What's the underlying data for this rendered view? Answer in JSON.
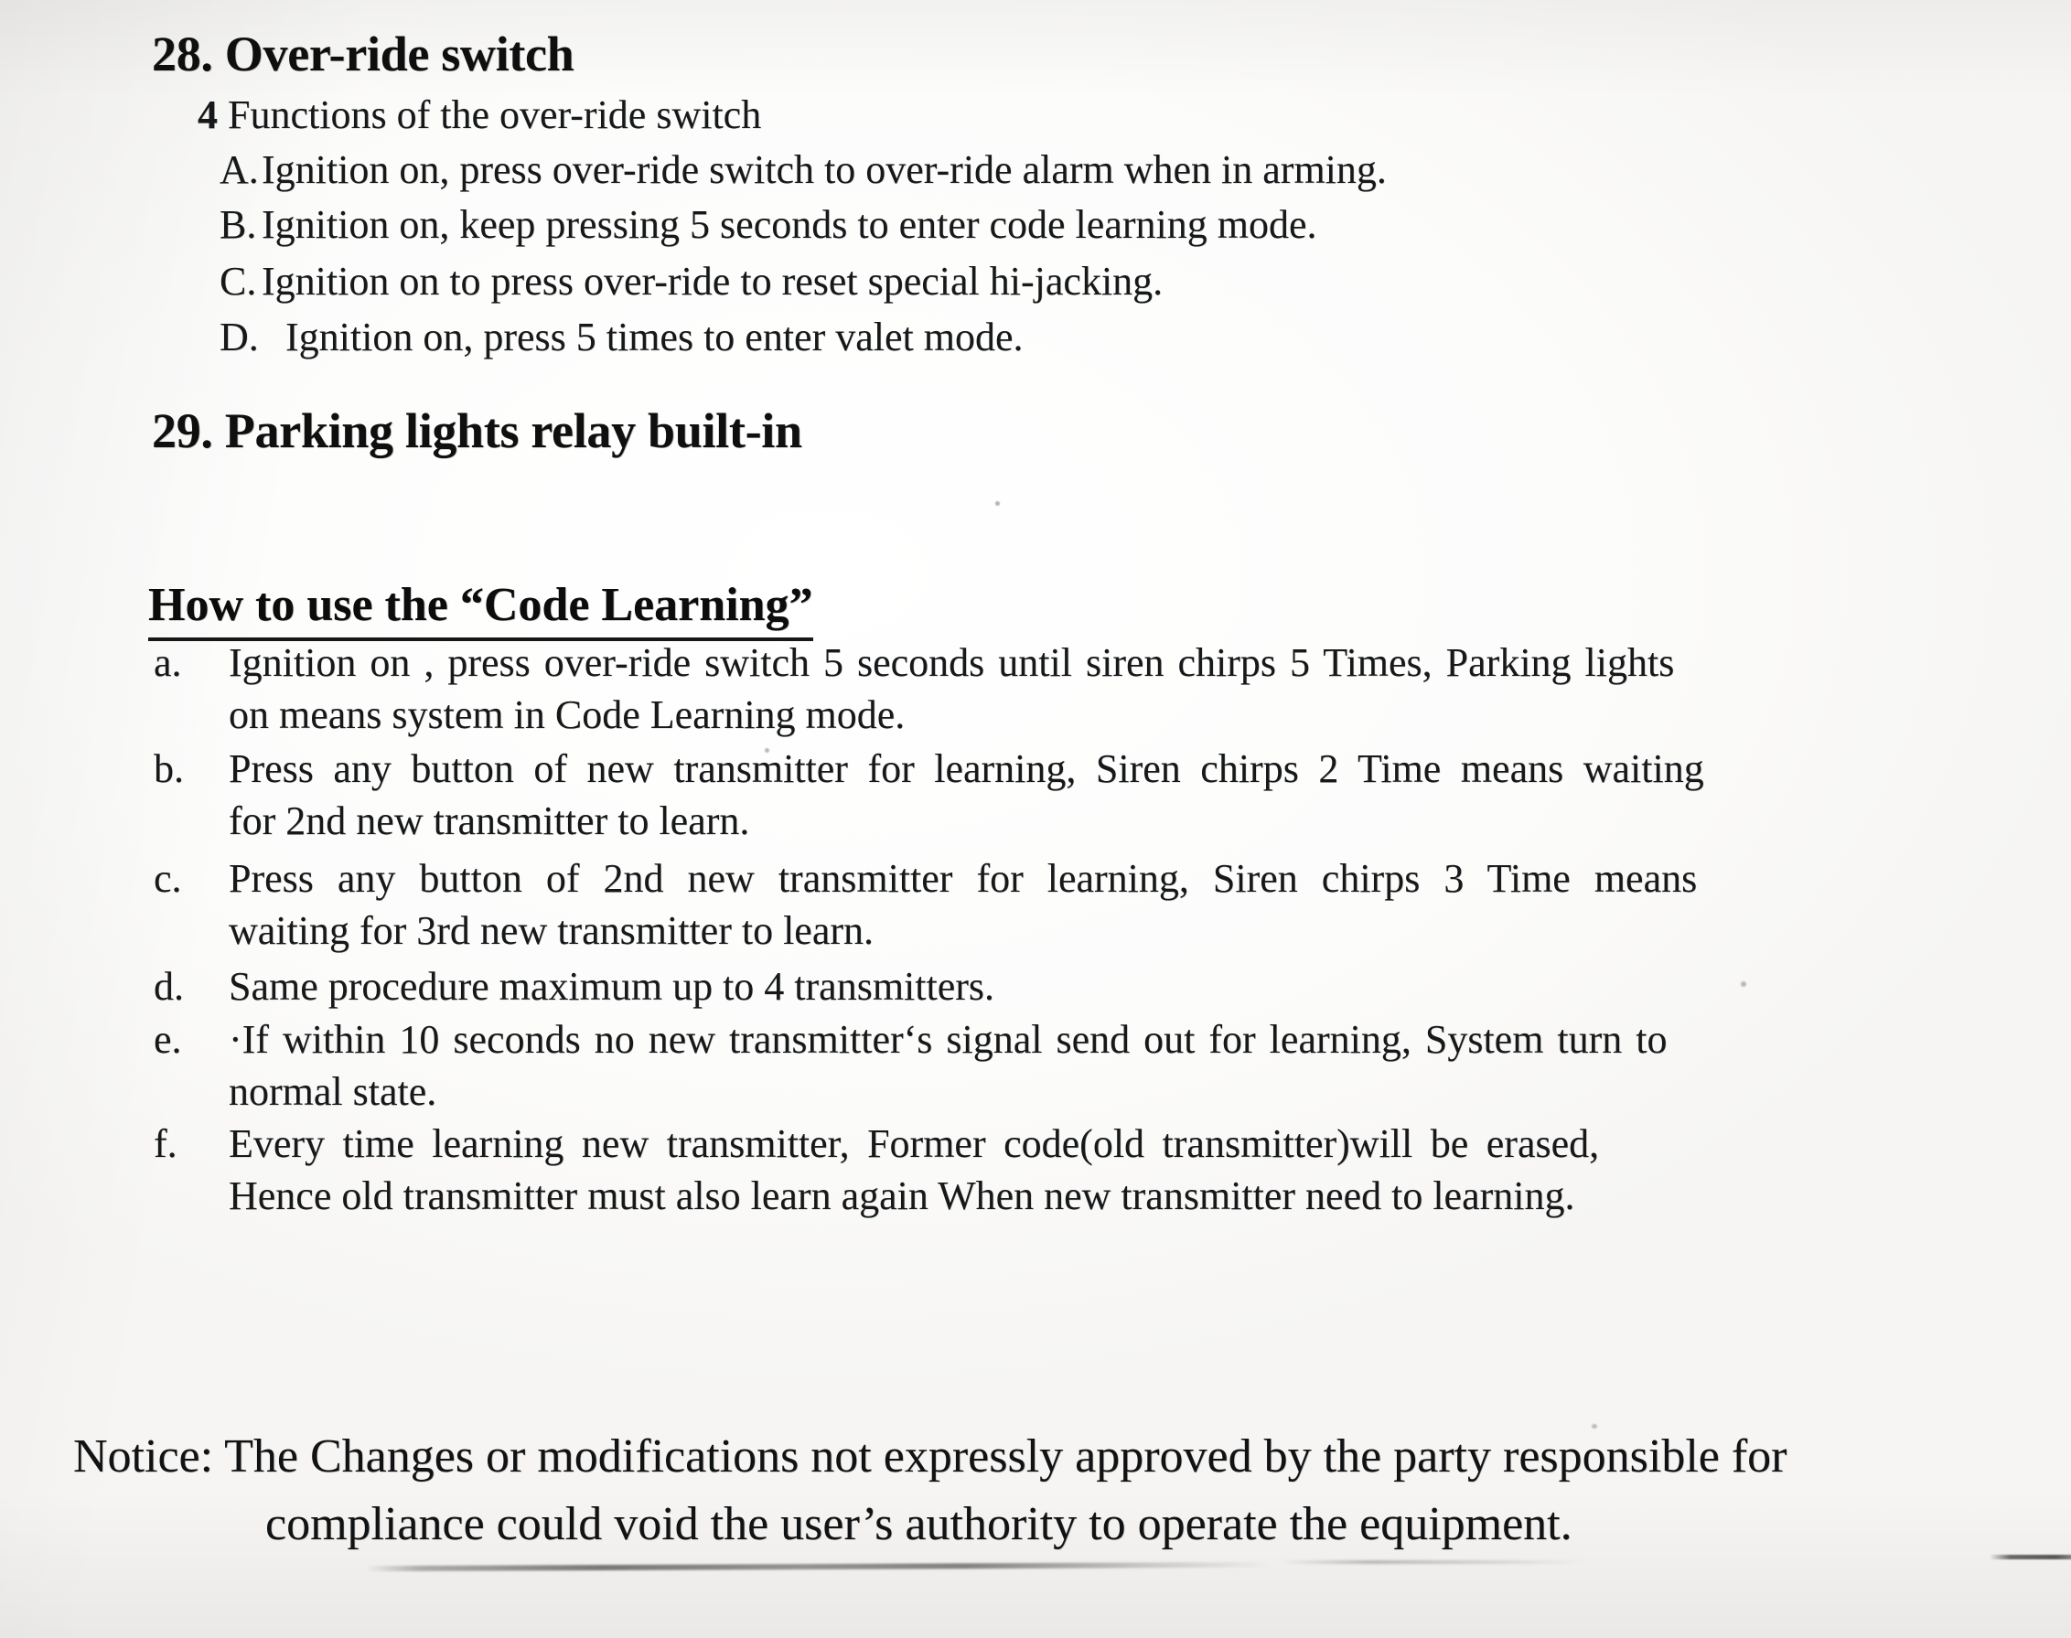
{
  "document": {
    "sections": [
      {
        "number": "28.",
        "title": "Over-ride switch",
        "heading_full": "28. Over-ride switch",
        "subheading_num": "4",
        "subheading_text": " Functions of the over-ride switch",
        "options": [
          {
            "letter": "A.",
            "text": "Ignition on, press over-ride switch to over-ride alarm when in arming."
          },
          {
            "letter": "B.",
            "text": "Ignition on, keep pressing 5 seconds to enter code learning mode."
          },
          {
            "letter": "C.",
            "text": "Ignition on to press over-ride to reset special hi-jacking."
          },
          {
            "letter": "D.",
            "text": "Ignition on, press 5 times to enter valet mode."
          }
        ]
      },
      {
        "number": "29.",
        "title": "Parking lights relay built-in",
        "heading_full": "29. Parking lights relay built-in"
      }
    ],
    "code_learning": {
      "heading": "How to use the “Code Learning”",
      "items": [
        {
          "marker": "a.",
          "line1": "Ignition on , press over-ride switch 5 seconds until siren chirps 5 Times, Parking lights",
          "line2": "on means system in Code Learning mode.",
          "full": "Ignition on , press over-ride switch 5 seconds until siren chirps 5 Times, Parking lights on means system in Code Learning mode."
        },
        {
          "marker": "b.",
          "line1": "Press any button of new transmitter for learning, Siren chirps 2 Time means waiting",
          "line2": "for 2nd new transmitter to learn.",
          "full": "Press any button of new transmitter for learning, Siren chirps 2 Time means waiting for 2nd new transmitter to learn."
        },
        {
          "marker": "c.",
          "line1": "Press any button of 2nd new transmitter for learning, Siren chirps 3 Time means",
          "line2": "waiting for 3rd new transmitter to learn.",
          "full": "Press any button of 2nd new transmitter for learning, Siren chirps 3 Time means waiting for 3rd new transmitter to learn."
        },
        {
          "marker": "d.",
          "line1": "Same procedure maximum up to 4 transmitters.",
          "line2": "",
          "full": "Same procedure maximum up to 4 transmitters."
        },
        {
          "marker": "e.",
          "line1": "·If within 10 seconds no new transmitter‘s signal send out for learning, System turn to",
          "line2": "normal state.",
          "full": "·If within 10 seconds no new transmitter‘s signal send out for learning, System turn to normal state."
        },
        {
          "marker": "f.",
          "line1": "Every time learning new transmitter, Former code(old transmitter)will be erased,",
          "line2": "Hence old transmitter must also learn again When new transmitter need to learning.",
          "full": "Every time learning new transmitter, Former code(old transmitter)will be erased, Hence old transmitter must also learn again When new transmitter need to learning."
        }
      ]
    },
    "notice": {
      "line1": "Notice: The Changes or modifications not expressly approved by the party responsible for",
      "line2": "compliance could void the user’s authority to operate the equipment.",
      "label": "Notice:",
      "full": "Notice: The Changes or modifications not expressly approved by the party responsible for compliance could void the user’s authority to operate the equipment."
    }
  },
  "colors": {
    "page_background": "#ffffff",
    "ink": "#141414",
    "heading_ink": "#0f0f0f",
    "artifact": "#282828"
  }
}
